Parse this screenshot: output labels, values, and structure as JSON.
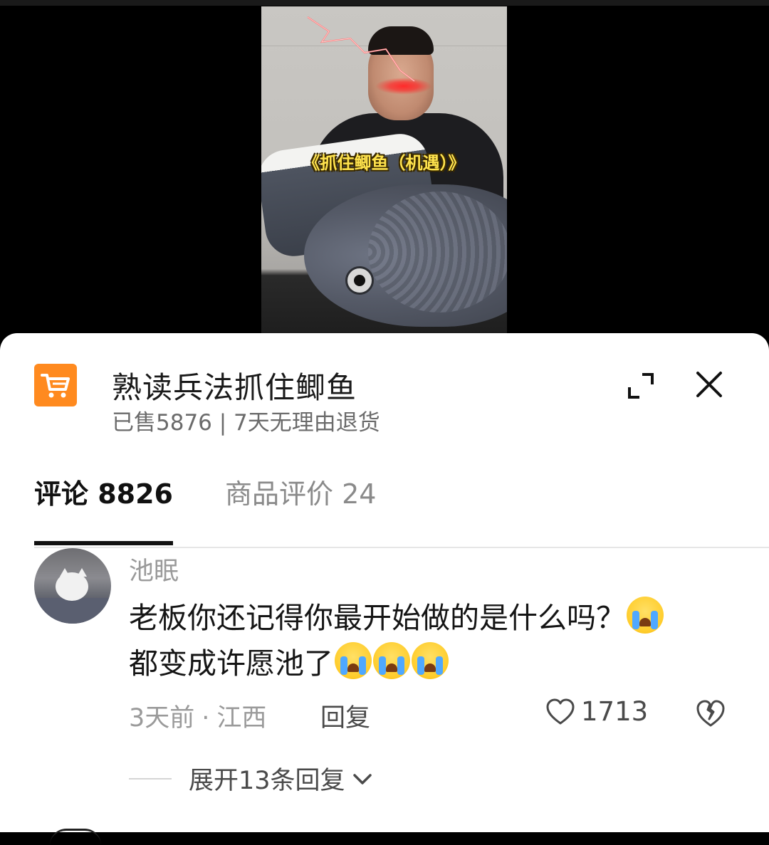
{
  "video": {
    "caption": "《抓住鲫鱼（机遇）》"
  },
  "product": {
    "title": "熟读兵法抓住鲫鱼",
    "subtitle": "已售5876 | 7天无理由退货",
    "accent_color": "#ff8a1f",
    "icon": "shopping-cart-icon"
  },
  "header_actions": {
    "expand_icon": "expand-icon",
    "close_icon": "close-icon"
  },
  "tabs": [
    {
      "label": "评论 8826",
      "active": true
    },
    {
      "label": "商品评价 24",
      "active": false
    }
  ],
  "comment": {
    "username": "池眠",
    "text_line1": "老板你还记得你最开始做的是什么吗？",
    "text_line2": "都变成许愿池了",
    "time": "3天前",
    "separator": "·",
    "location": "江西",
    "reply_label": "回复",
    "likes": "1713",
    "expand_label": "展开13条回复"
  }
}
